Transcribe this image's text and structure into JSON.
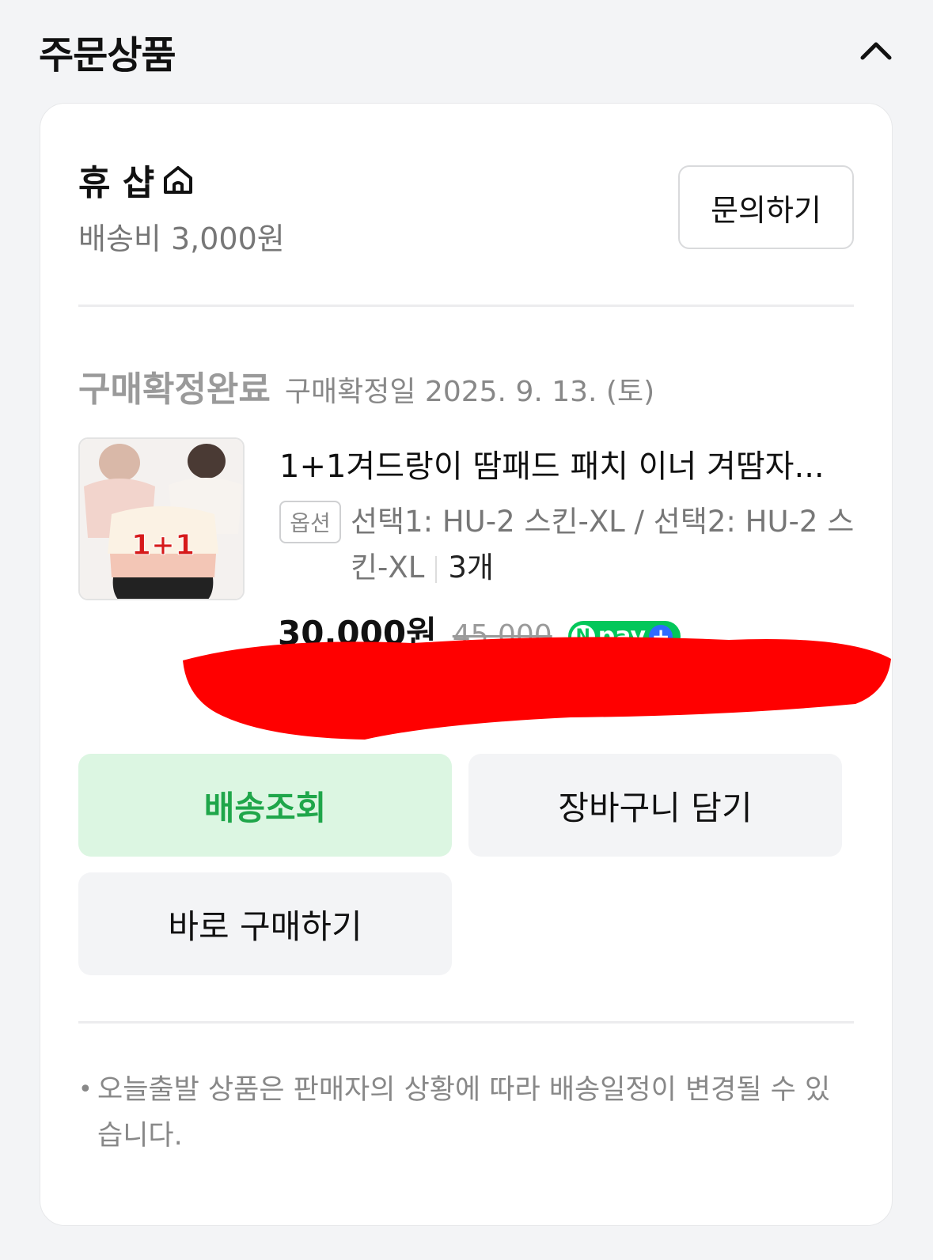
{
  "header": {
    "title": "주문상품"
  },
  "store": {
    "name": "휴 샵",
    "shipping_fee": "배송비 3,000원",
    "inquiry_label": "문의하기"
  },
  "order": {
    "status": "구매확정완료",
    "confirm_date": "구매확정일 2025. 9. 13. (토)",
    "product": {
      "name": "1+1겨드랑이 땀패드 패치 이너 겨땀자...",
      "option_badge": "옵션",
      "option_text": "선택1: HU-2 스킨-XL / 선택2: HU-2 스킨-XL",
      "quantity": "3개",
      "price": "30,000원",
      "original_price": "45,000",
      "thumbnail_label": "1+1",
      "payment_badge": "pay"
    }
  },
  "actions": {
    "tracking": "배송조회",
    "cart": "장바구니 담기",
    "buy_now": "바로 구매하기"
  },
  "notice": {
    "bullet": "•",
    "text": "오늘출발 상품은 판매자의 상황에 따라 배송일정이 변경될 수 있습니다."
  }
}
